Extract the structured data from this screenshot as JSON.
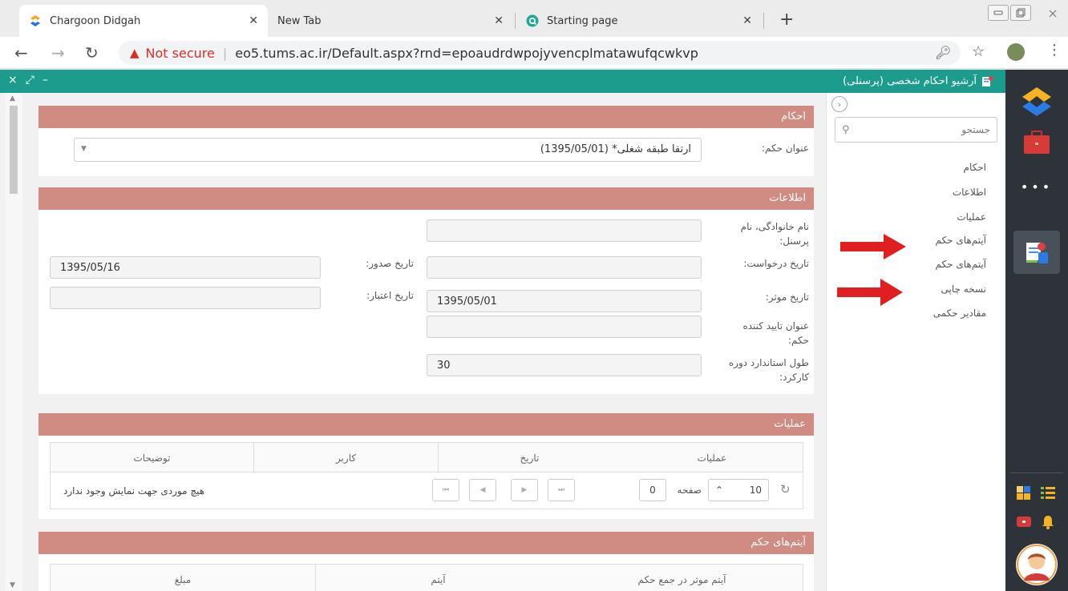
{
  "browser": {
    "tabs": [
      {
        "title": "Chargoon Didgah",
        "active": true
      },
      {
        "title": "New Tab",
        "active": false
      },
      {
        "title": "Starting page",
        "active": false
      }
    ],
    "close_glyph": "✕",
    "new_tab_glyph": "+",
    "not_secure": "Not secure",
    "url": "eo5.tums.ac.ir/Default.aspx?rnd=epoaudrdwpojyvencplmatawufqcwkvp"
  },
  "app": {
    "window_title": "آرشیو احکام شخصی (پرسنلی)",
    "accent": "#1b9c8c",
    "panel_header_color": "#d08c83",
    "arrow_color": "#e02020"
  },
  "subnav": {
    "search_placeholder": "جستجو",
    "items": [
      "احکام",
      "اطلاعات",
      "عملیات",
      "آیتم‌های حکم",
      "آیتم‌های حکم",
      "نسخه چاپی",
      "مقادیر حکمی"
    ]
  },
  "sections": {
    "ahkam": {
      "title": "احکام",
      "title_label": "عنوان حکم:",
      "title_value": "ارتقا طبقه شغلی* (1395/05/01)"
    },
    "info": {
      "title": "اطلاعات",
      "name_label": "نام خانوادگی، نام پرسنل:",
      "name_value": "",
      "request_date_label": "تاریخ درخواست:",
      "request_date_value": "",
      "issue_date_label": "تاریخ صدور:",
      "issue_date_value": "1395/05/16",
      "effective_date_label": "تاریخ موثر:",
      "effective_date_value": "1395/05/01",
      "validity_date_label": "تاریخ اعتبار:",
      "validity_date_value": "",
      "approver_label": "عنوان تایید کننده حکم:",
      "approver_value": "",
      "work_period_label": "طول استاندارد دوره کارکرد:",
      "work_period_value": "30"
    },
    "ops": {
      "title": "عملیات",
      "columns": [
        "عملیات",
        "تاریخ",
        "کاربر",
        "توضیحات"
      ],
      "empty_message": "هیچ موردی جهت نمایش وجود ندارد",
      "page_size": "10",
      "page_label": "صفحه",
      "page_value": "0"
    },
    "items": {
      "title": "آیتم‌های حکم",
      "columns": [
        "آیتم موثر در جمع حکم",
        "آیتم",
        "مبلغ"
      ]
    }
  }
}
